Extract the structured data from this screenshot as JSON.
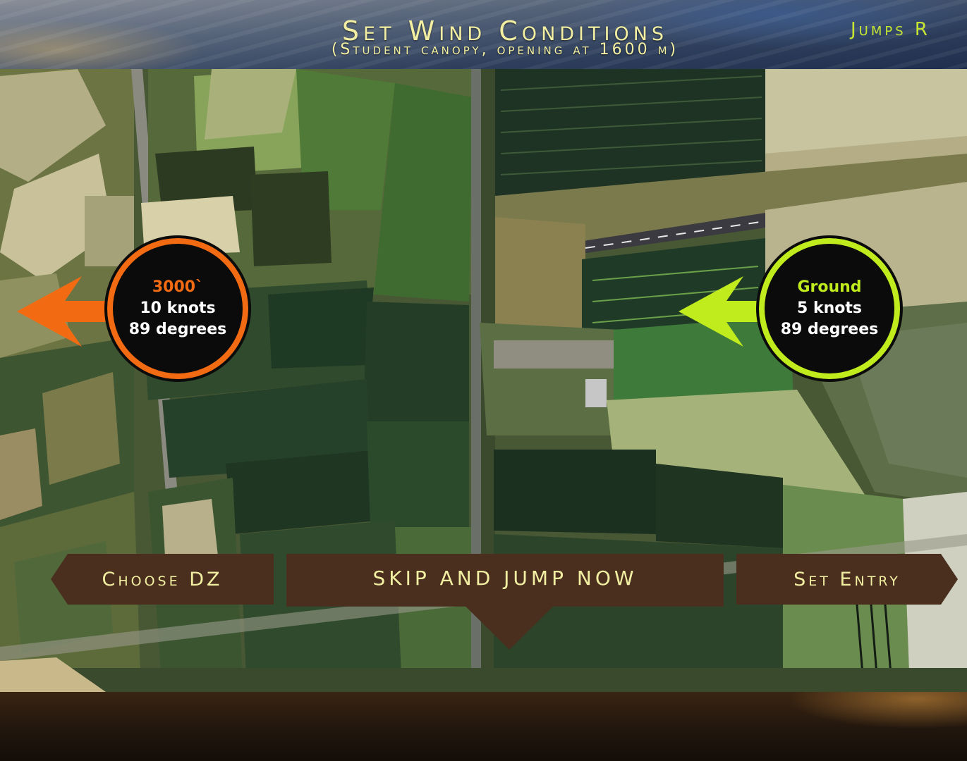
{
  "header": {
    "title": "Set Wind Conditions",
    "subtitle": "(Student canopy, opening at 1600 m)",
    "jumps_link": "Jumps R"
  },
  "wind": {
    "altitude": {
      "label": "3000`",
      "speed": "10 knots",
      "direction": "89 degrees",
      "color": "#f26b12"
    },
    "ground": {
      "label": "Ground",
      "speed": "5 knots",
      "direction": "89 degrees",
      "color": "#c0ec1e"
    }
  },
  "buttons": {
    "choose_dz": "Choose DZ",
    "skip_jump": "SKIP AND JUMP NOW",
    "set_entry": "Set Entry"
  },
  "map": {
    "type": "satellite-view"
  }
}
